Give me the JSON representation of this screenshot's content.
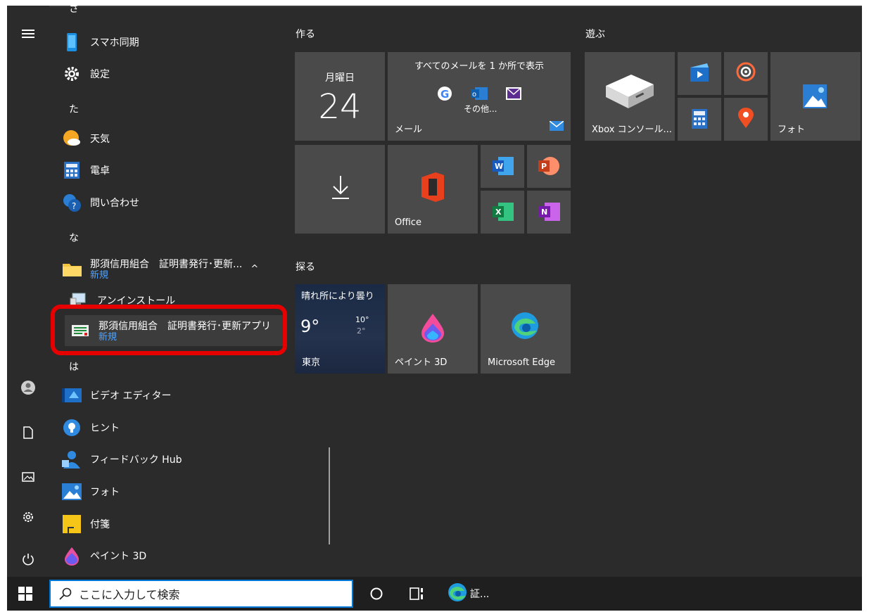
{
  "applist": {
    "letters": {
      "sa_partial": "さ",
      "ta": "た",
      "na": "な",
      "ha": "は"
    },
    "items": {
      "sumaho": "スマホ同期",
      "settei": "設定",
      "tenki": "天気",
      "dentaku": "電卓",
      "toiawase": "問い合わせ",
      "folder": {
        "label": "那須信用組合　証明書発行･更新...",
        "sub": "新規",
        "chevron": "^"
      },
      "uninstall": "アンインストール",
      "app_selected": {
        "label": "那須信用組合　証明書発行･更新アプリ",
        "sub": "新規"
      },
      "video": "ビデオ エディター",
      "hint": "ヒント",
      "feedback": "フィードバック Hub",
      "photo": "フォト",
      "fusen": "付箋",
      "paint3d": "ペイント 3D"
    }
  },
  "tiles": {
    "group_create": "作る",
    "group_explore": "探る",
    "group_play": "遊ぶ",
    "calendar": {
      "weekday": "月曜日",
      "day": "24"
    },
    "mail": {
      "header": "すべてのメールを 1 か所で表示",
      "more": "その他...",
      "label": "メール"
    },
    "office": "Office",
    "weather": {
      "title": "晴れ所により曇り",
      "temp": "9°",
      "high": "10°",
      "low": "2°",
      "city": "東京"
    },
    "paint3d": "ペイント 3D",
    "edge": "Microsoft Edge",
    "xbox": "Xbox コンソール...",
    "photo": "フォト"
  },
  "taskbar": {
    "search_placeholder": "ここに入力して検索",
    "edge_task": "証..."
  }
}
